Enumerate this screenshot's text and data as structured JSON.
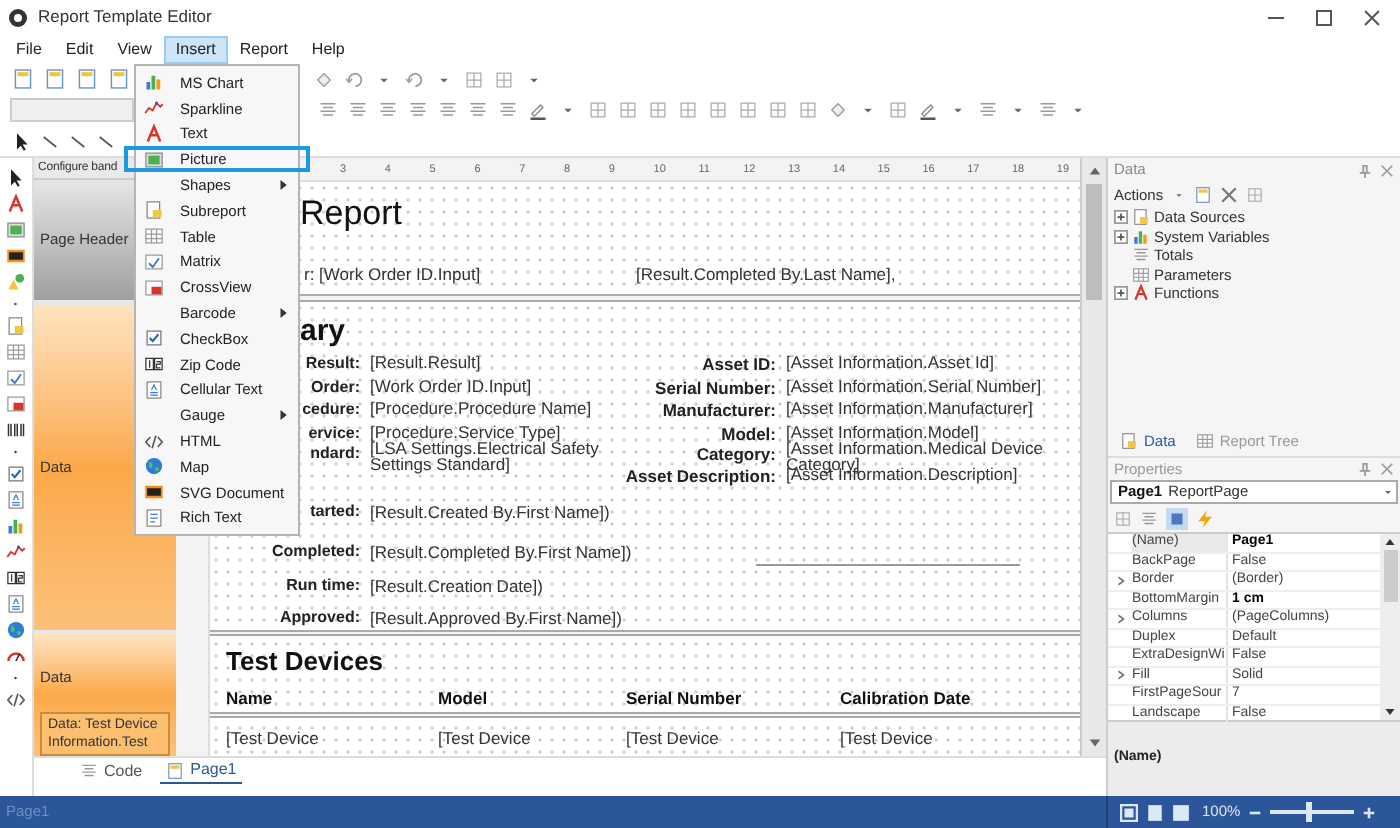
{
  "window": {
    "title": "Report Template Editor"
  },
  "menu": [
    {
      "label": "File",
      "selected": false
    },
    {
      "label": "Edit",
      "selected": false
    },
    {
      "label": "View",
      "selected": false
    },
    {
      "label": "Insert",
      "selected": true
    },
    {
      "label": "Report",
      "selected": false
    },
    {
      "label": "Help",
      "selected": false
    }
  ],
  "insert_menu": [
    {
      "label": "MS Chart",
      "submenu": false,
      "highlighted": false
    },
    {
      "label": "Sparkline",
      "submenu": false,
      "highlighted": false
    },
    {
      "label": "Text",
      "submenu": false,
      "highlighted": false
    },
    {
      "label": "Picture",
      "submenu": false,
      "highlighted": true
    },
    {
      "label": "Shapes",
      "submenu": true,
      "highlighted": false
    },
    {
      "label": "Subreport",
      "submenu": false,
      "highlighted": false
    },
    {
      "label": "Table",
      "submenu": false,
      "highlighted": false
    },
    {
      "label": "Matrix",
      "submenu": false,
      "highlighted": false
    },
    {
      "label": "CrossView",
      "submenu": false,
      "highlighted": false
    },
    {
      "label": "Barcode",
      "submenu": true,
      "highlighted": false
    },
    {
      "label": "CheckBox",
      "submenu": false,
      "highlighted": false
    },
    {
      "label": "Zip Code",
      "submenu": false,
      "highlighted": false
    },
    {
      "label": "Cellular Text",
      "submenu": false,
      "highlighted": false
    },
    {
      "label": "Gauge",
      "submenu": true,
      "highlighted": false
    },
    {
      "label": "HTML",
      "submenu": false,
      "highlighted": false
    },
    {
      "label": "Map",
      "submenu": false,
      "highlighted": false
    },
    {
      "label": "SVG Document",
      "submenu": false,
      "highlighted": false
    },
    {
      "label": "Rich Text",
      "submenu": false,
      "highlighted": false
    }
  ],
  "bands_panel": {
    "header": "Configure band",
    "bands": [
      {
        "label": "Page Header",
        "kind": "header"
      },
      {
        "label": "Data",
        "kind": "data"
      },
      {
        "label": "Data",
        "kind": "data",
        "data_source": "Data: Test Device Information.Test"
      }
    ]
  },
  "ruler_marks": [
    "3",
    "4",
    "5",
    "6",
    "7",
    "8",
    "9",
    "10",
    "11",
    "12",
    "13",
    "14",
    "15",
    "16",
    "17",
    "18",
    "19"
  ],
  "report": {
    "title": "Report",
    "header_fields": [
      "r: [Work Order ID.Input]",
      "[Result.Completed By.Last Name],"
    ],
    "summary": {
      "heading": "ary",
      "left": [
        {
          "label": "Result:",
          "value": "[Result.Result]"
        },
        {
          "label": "Order:",
          "value": "[Work Order ID.Input]"
        },
        {
          "label": "cedure:",
          "value": "[Procedure.Procedure Name]"
        },
        {
          "label": "ervice:",
          "value": "[Procedure.Service Type]"
        },
        {
          "label": "ndard:",
          "value": "[LSA Settings.Electrical Safety Settings Standard]"
        }
      ],
      "right": [
        {
          "label": "Asset ID:",
          "value": "[Asset Information.Asset Id]"
        },
        {
          "label": "Serial Number:",
          "value": "[Asset Information.Serial Number]"
        },
        {
          "label": "Manufacturer:",
          "value": "[Asset Information.Manufacturer]"
        },
        {
          "label": "Model:",
          "value": "[Asset Information.Model]"
        },
        {
          "label": "Category:",
          "value": "[Asset Information.Medical Device Category]"
        },
        {
          "label": "Asset Description:",
          "value": "[Asset Information.Description]"
        }
      ],
      "signoff": [
        {
          "label": "tarted:",
          "value": "[Result.Created By.First Name])"
        },
        {
          "label": "Completed:",
          "value": "[Result.Completed By.First Name])"
        },
        {
          "label": "Run time:",
          "value": "[Result.Creation Date])"
        },
        {
          "label": "Approved:",
          "value": "[Result.Approved By.First Name])"
        }
      ]
    },
    "test_devices": {
      "heading": "Test Devices",
      "columns": [
        "Name",
        "Model",
        "Serial Number",
        "Calibration Date"
      ],
      "row": [
        "[Test Device",
        "[Test Device",
        "[Test Device",
        "[Test Device"
      ]
    }
  },
  "doc_tabs": [
    {
      "label": "Code",
      "selected": false
    },
    {
      "label": "Page1",
      "selected": true
    }
  ],
  "data_panel": {
    "title": "Data",
    "actions": "Actions",
    "tree": [
      {
        "label": "Data Sources",
        "expandable": true
      },
      {
        "label": "System Variables",
        "expandable": true
      },
      {
        "label": "Totals",
        "expandable": false
      },
      {
        "label": "Parameters",
        "expandable": false
      },
      {
        "label": "Functions",
        "expandable": true
      }
    ]
  },
  "panel_tabs": [
    {
      "label": "Data",
      "selected": true
    },
    {
      "label": "Report Tree",
      "selected": false
    }
  ],
  "properties": {
    "title": "Properties",
    "object": "Page1",
    "object_type": "ReportPage",
    "rows": [
      {
        "name": "(Name)",
        "value": "Page1",
        "bold": true,
        "expandable": false
      },
      {
        "name": "BackPage",
        "value": "False",
        "bold": false,
        "expandable": false
      },
      {
        "name": "Border",
        "value": "(Border)",
        "bold": false,
        "expandable": true
      },
      {
        "name": "BottomMargin",
        "value": "1 cm",
        "bold": true,
        "expandable": false
      },
      {
        "name": "Columns",
        "value": "(PageColumns)",
        "bold": false,
        "expandable": true
      },
      {
        "name": "Duplex",
        "value": "Default",
        "bold": false,
        "expandable": false
      },
      {
        "name": "ExtraDesignWi",
        "value": "False",
        "bold": false,
        "expandable": false
      },
      {
        "name": "Fill",
        "value": "Solid",
        "bold": false,
        "expandable": true
      },
      {
        "name": "FirstPageSour",
        "value": "7",
        "bold": false,
        "expandable": false
      },
      {
        "name": "Landscape",
        "value": "False",
        "bold": false,
        "expandable": false
      }
    ],
    "description": "(Name)"
  },
  "status_bar": {
    "page": "Page1",
    "zoom": "100%",
    "zoom_slider": {
      "level": 0.45
    }
  }
}
